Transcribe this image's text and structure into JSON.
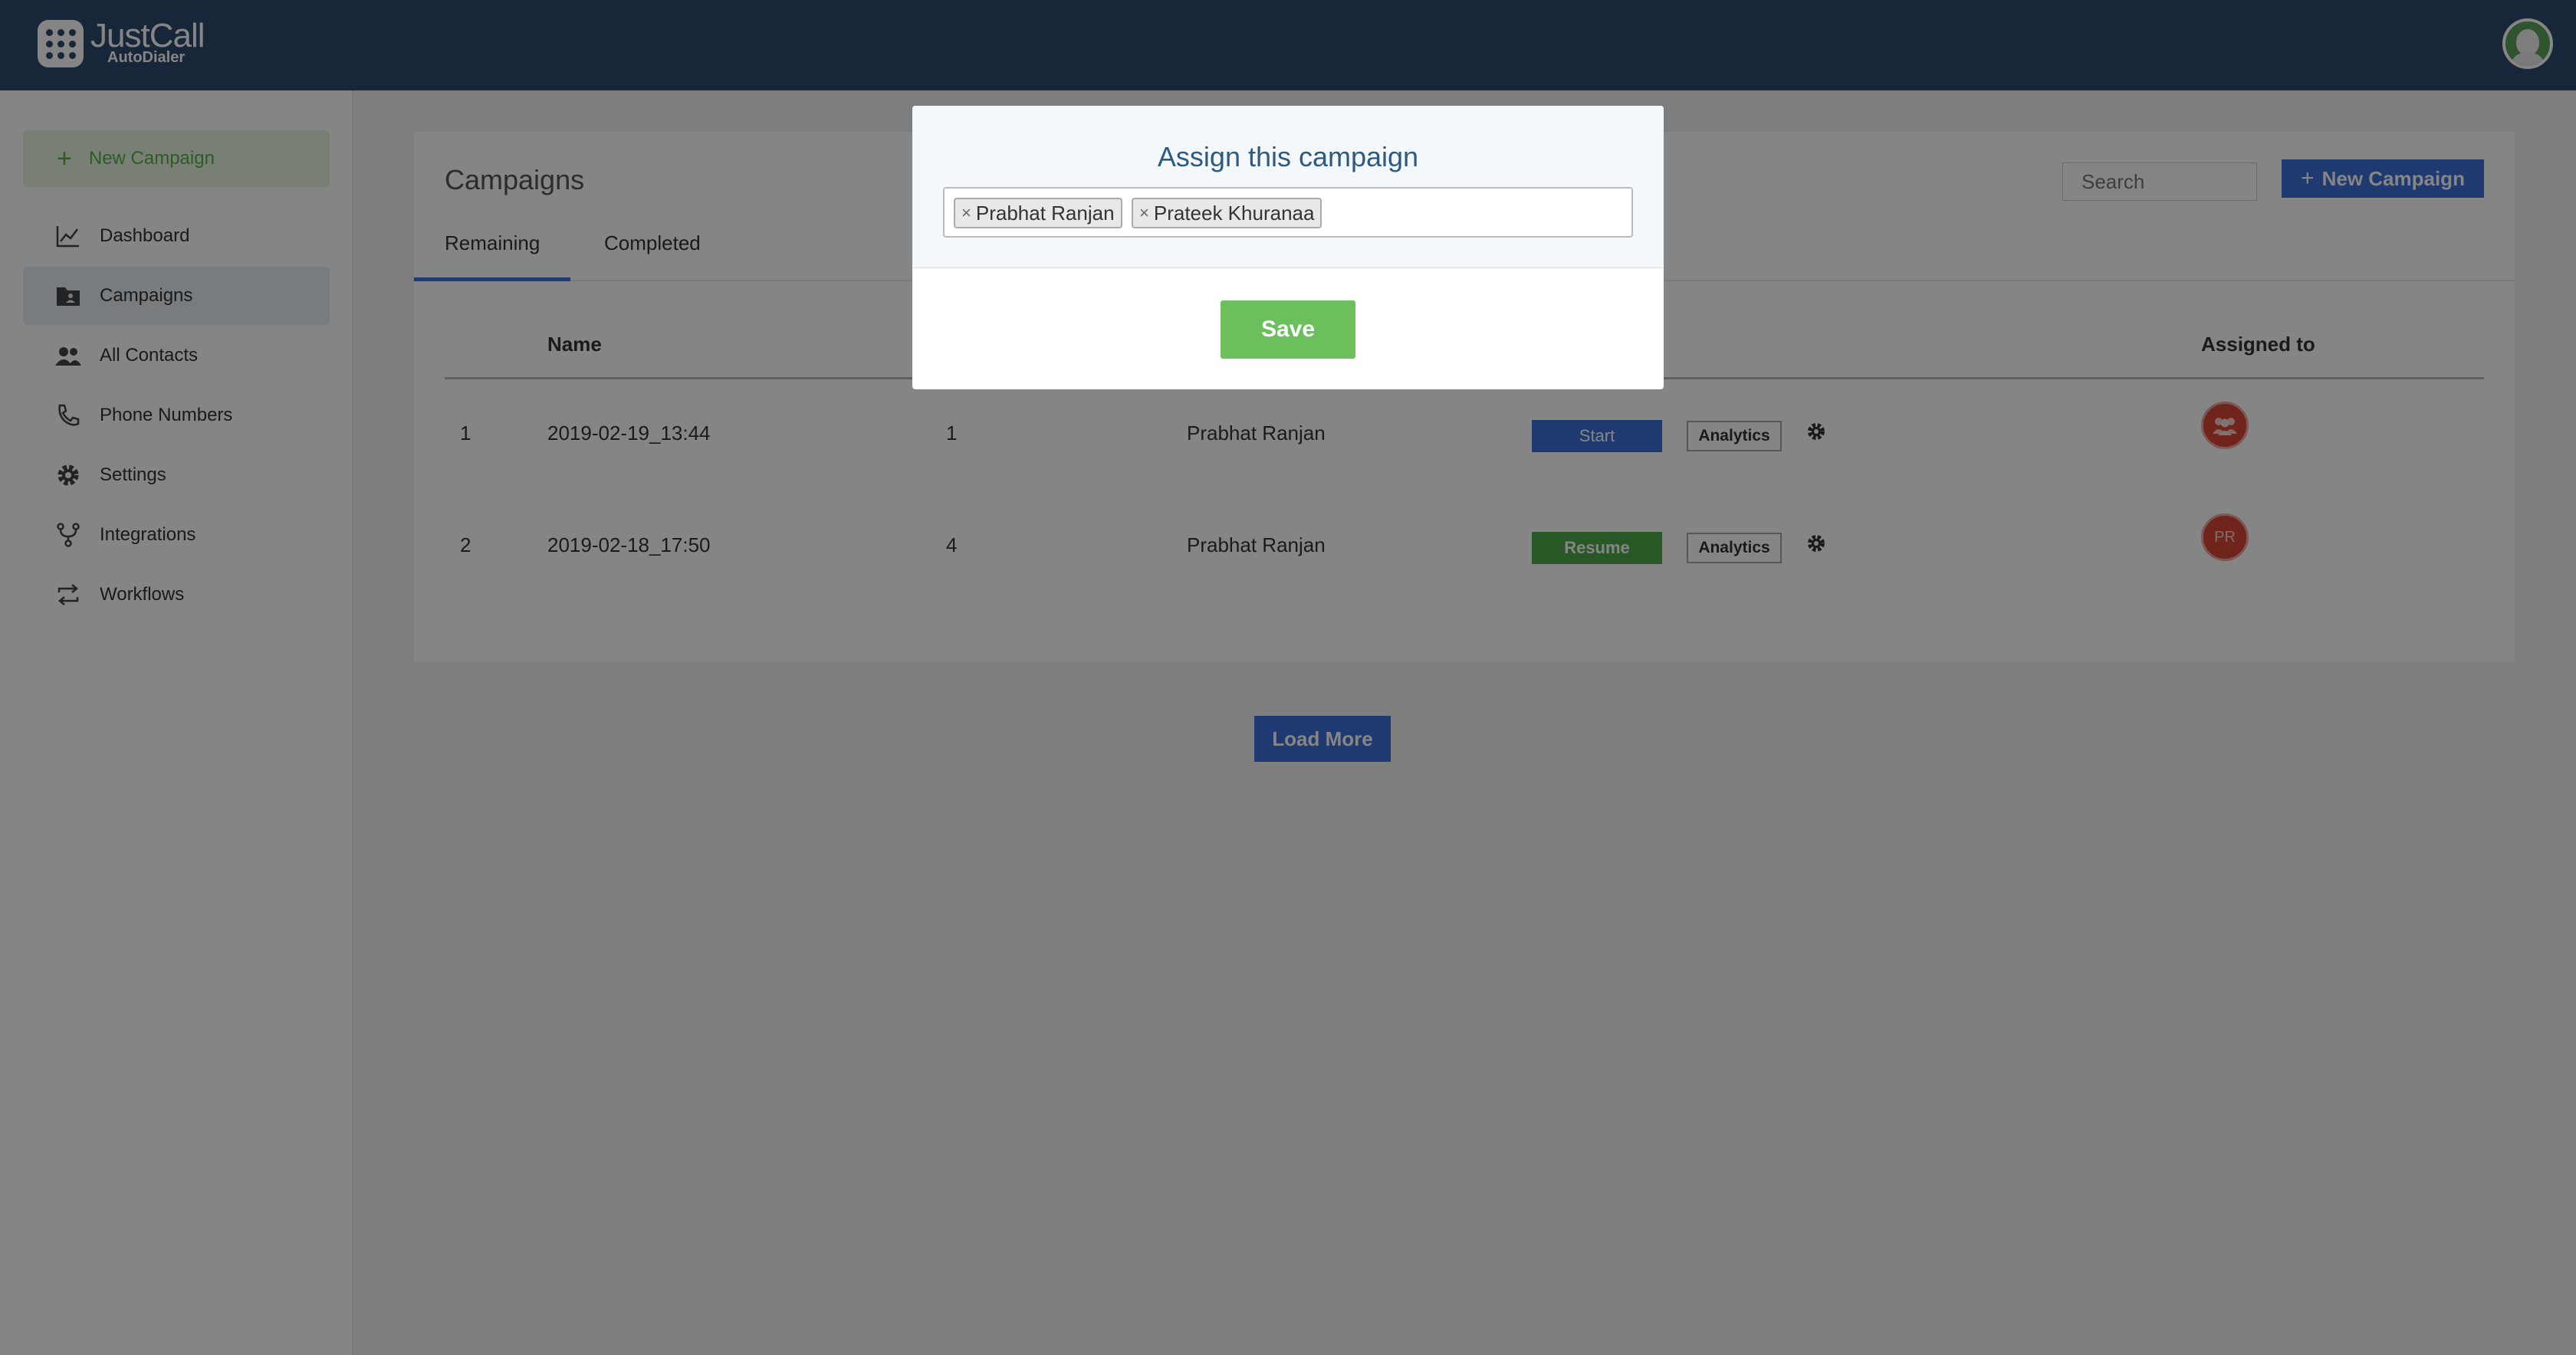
{
  "brand": {
    "name": "JustCall",
    "sub": "AutoDialer"
  },
  "sidebar": {
    "new_campaign": "New Campaign",
    "items": [
      {
        "label": "Dashboard",
        "icon": "chart-line-icon"
      },
      {
        "label": "Campaigns",
        "icon": "folder-contact-icon"
      },
      {
        "label": "All Contacts",
        "icon": "people-icon"
      },
      {
        "label": "Phone Numbers",
        "icon": "phone-icon"
      },
      {
        "label": "Settings",
        "icon": "gear-icon"
      },
      {
        "label": "Integrations",
        "icon": "integration-icon"
      },
      {
        "label": "Workflows",
        "icon": "repeat-icon"
      }
    ]
  },
  "main": {
    "title": "Campaigns",
    "tabs": [
      "Remaining",
      "Completed"
    ],
    "search_placeholder": "Search",
    "new_campaign_button": "New Campaign",
    "columns": {
      "name": "Name",
      "assigned_to": "Assigned to"
    },
    "rows": [
      {
        "index": "1",
        "name": "2019-02-19_13:44",
        "count": "1",
        "owner": "Prabhat Ranjan",
        "action": "Start",
        "analytics": "Analytics",
        "assignee": ""
      },
      {
        "index": "2",
        "name": "2019-02-18_17:50",
        "count": "4",
        "owner": "Prabhat Ranjan",
        "action": "Resume",
        "analytics": "Analytics",
        "assignee": "PR"
      }
    ],
    "load_more": "Load More"
  },
  "modal": {
    "title": "Assign this campaign",
    "tags": [
      "Prabhat Ranjan",
      "Prateek Khuranaa"
    ],
    "save": "Save"
  },
  "colors": {
    "topbar": "#2d4a6c",
    "primary": "#3b6fd8",
    "success": "#4caa47",
    "save": "#6bbf5d",
    "avatar": "#d64535"
  }
}
